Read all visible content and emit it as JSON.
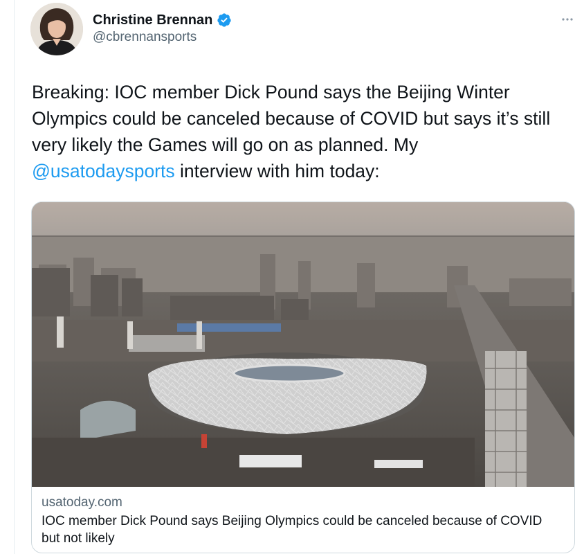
{
  "tweet": {
    "author": {
      "display_name": "Christine Brennan",
      "handle": "@cbrennansports",
      "verified": true
    },
    "text_before_mention": "Breaking: IOC member Dick Pound says the Beijing Winter Olympics could be canceled because of COVID but says it’s still very likely the Games will go on as planned. My",
    "mention": "@usatodaysports",
    "text_after_mention": " interview with him today:",
    "card": {
      "domain": "usatoday.com",
      "title": "IOC member Dick Pound says Beijing Olympics could be canceled because of COVID but not likely"
    }
  },
  "icons": {
    "verified": "verified-badge-icon",
    "more": "more-options-icon"
  },
  "colors": {
    "link": "#1d9bf0",
    "verified": "#1d9bf0",
    "secondary_text": "#536471",
    "border": "#cfd9de"
  }
}
